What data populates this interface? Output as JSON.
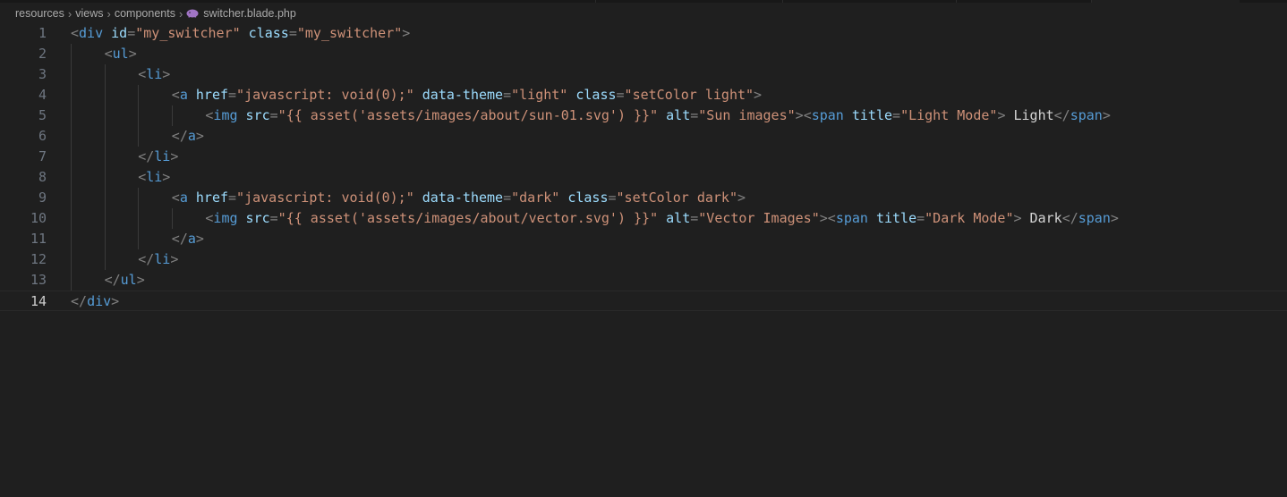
{
  "breadcrumb": {
    "items": [
      "resources",
      "views",
      "components"
    ],
    "file": "switcher.blade.php"
  },
  "editor": {
    "current_line": 14,
    "lines": [
      {
        "n": "1",
        "indent": 0,
        "tokens": [
          [
            "p",
            "<"
          ],
          [
            "t",
            "div"
          ],
          [
            "a",
            " id"
          ],
          [
            "p",
            "="
          ],
          [
            "s",
            "\"my_switcher\""
          ],
          [
            "a",
            " class"
          ],
          [
            "p",
            "="
          ],
          [
            "s",
            "\"my_switcher\""
          ],
          [
            "p",
            ">"
          ]
        ]
      },
      {
        "n": "2",
        "indent": 1,
        "tokens": [
          [
            "p",
            "<"
          ],
          [
            "t",
            "ul"
          ],
          [
            "p",
            ">"
          ]
        ]
      },
      {
        "n": "3",
        "indent": 2,
        "tokens": [
          [
            "p",
            "<"
          ],
          [
            "t",
            "li"
          ],
          [
            "p",
            ">"
          ]
        ]
      },
      {
        "n": "4",
        "indent": 3,
        "tokens": [
          [
            "p",
            "<"
          ],
          [
            "t",
            "a"
          ],
          [
            "a",
            " href"
          ],
          [
            "p",
            "="
          ],
          [
            "s",
            "\"javascript: void(0);\""
          ],
          [
            "a",
            " data-theme"
          ],
          [
            "p",
            "="
          ],
          [
            "s",
            "\"light\""
          ],
          [
            "a",
            " class"
          ],
          [
            "p",
            "="
          ],
          [
            "s",
            "\"setColor light\""
          ],
          [
            "p",
            ">"
          ]
        ]
      },
      {
        "n": "5",
        "indent": 4,
        "tokens": [
          [
            "p",
            "<"
          ],
          [
            "t",
            "img"
          ],
          [
            "a",
            " src"
          ],
          [
            "p",
            "="
          ],
          [
            "s",
            "\"{{ asset('assets/images/about/sun-01.svg') }}\""
          ],
          [
            "a",
            " alt"
          ],
          [
            "p",
            "="
          ],
          [
            "s",
            "\"Sun images\""
          ],
          [
            "p",
            ">"
          ],
          [
            "p",
            "<"
          ],
          [
            "t",
            "span"
          ],
          [
            "a",
            " title"
          ],
          [
            "p",
            "="
          ],
          [
            "s",
            "\"Light Mode\""
          ],
          [
            "p",
            ">"
          ],
          [
            "x",
            " Light"
          ],
          [
            "p",
            "</"
          ],
          [
            "t",
            "span"
          ],
          [
            "p",
            ">"
          ]
        ]
      },
      {
        "n": "6",
        "indent": 3,
        "tokens": [
          [
            "p",
            "</"
          ],
          [
            "t",
            "a"
          ],
          [
            "p",
            ">"
          ]
        ]
      },
      {
        "n": "7",
        "indent": 2,
        "tokens": [
          [
            "p",
            "</"
          ],
          [
            "t",
            "li"
          ],
          [
            "p",
            ">"
          ]
        ]
      },
      {
        "n": "8",
        "indent": 2,
        "tokens": [
          [
            "p",
            "<"
          ],
          [
            "t",
            "li"
          ],
          [
            "p",
            ">"
          ]
        ]
      },
      {
        "n": "9",
        "indent": 3,
        "tokens": [
          [
            "p",
            "<"
          ],
          [
            "t",
            "a"
          ],
          [
            "a",
            " href"
          ],
          [
            "p",
            "="
          ],
          [
            "s",
            "\"javascript: void(0);\""
          ],
          [
            "a",
            " data-theme"
          ],
          [
            "p",
            "="
          ],
          [
            "s",
            "\"dark\""
          ],
          [
            "a",
            " class"
          ],
          [
            "p",
            "="
          ],
          [
            "s",
            "\"setColor dark\""
          ],
          [
            "p",
            ">"
          ]
        ]
      },
      {
        "n": "10",
        "indent": 4,
        "tokens": [
          [
            "p",
            "<"
          ],
          [
            "t",
            "img"
          ],
          [
            "a",
            " src"
          ],
          [
            "p",
            "="
          ],
          [
            "s",
            "\"{{ asset('assets/images/about/vector.svg') }}\""
          ],
          [
            "a",
            " alt"
          ],
          [
            "p",
            "="
          ],
          [
            "s",
            "\"Vector Images\""
          ],
          [
            "p",
            ">"
          ],
          [
            "p",
            "<"
          ],
          [
            "t",
            "span"
          ],
          [
            "a",
            " title"
          ],
          [
            "p",
            "="
          ],
          [
            "s",
            "\"Dark Mode\""
          ],
          [
            "p",
            ">"
          ],
          [
            "x",
            " Dark"
          ],
          [
            "p",
            "</"
          ],
          [
            "t",
            "span"
          ],
          [
            "p",
            ">"
          ]
        ]
      },
      {
        "n": "11",
        "indent": 3,
        "tokens": [
          [
            "p",
            "</"
          ],
          [
            "t",
            "a"
          ],
          [
            "p",
            ">"
          ]
        ]
      },
      {
        "n": "12",
        "indent": 2,
        "tokens": [
          [
            "p",
            "</"
          ],
          [
            "t",
            "li"
          ],
          [
            "p",
            ">"
          ]
        ]
      },
      {
        "n": "13",
        "indent": 1,
        "tokens": [
          [
            "p",
            "</"
          ],
          [
            "t",
            "ul"
          ],
          [
            "p",
            ">"
          ]
        ]
      },
      {
        "n": "14",
        "indent": 0,
        "tokens": [
          [
            "p",
            "</"
          ],
          [
            "t",
            "div"
          ],
          [
            "p",
            ">"
          ]
        ]
      }
    ]
  },
  "colors": {
    "background": "#1f1f1f",
    "tag": "#569cd6",
    "attribute": "#9cdcfe",
    "string": "#ce9178",
    "punctuation": "#808080",
    "text": "#d4d4d4",
    "line_number": "#6e7681",
    "line_number_active": "#cccccc",
    "php_icon": "#a074c4"
  }
}
